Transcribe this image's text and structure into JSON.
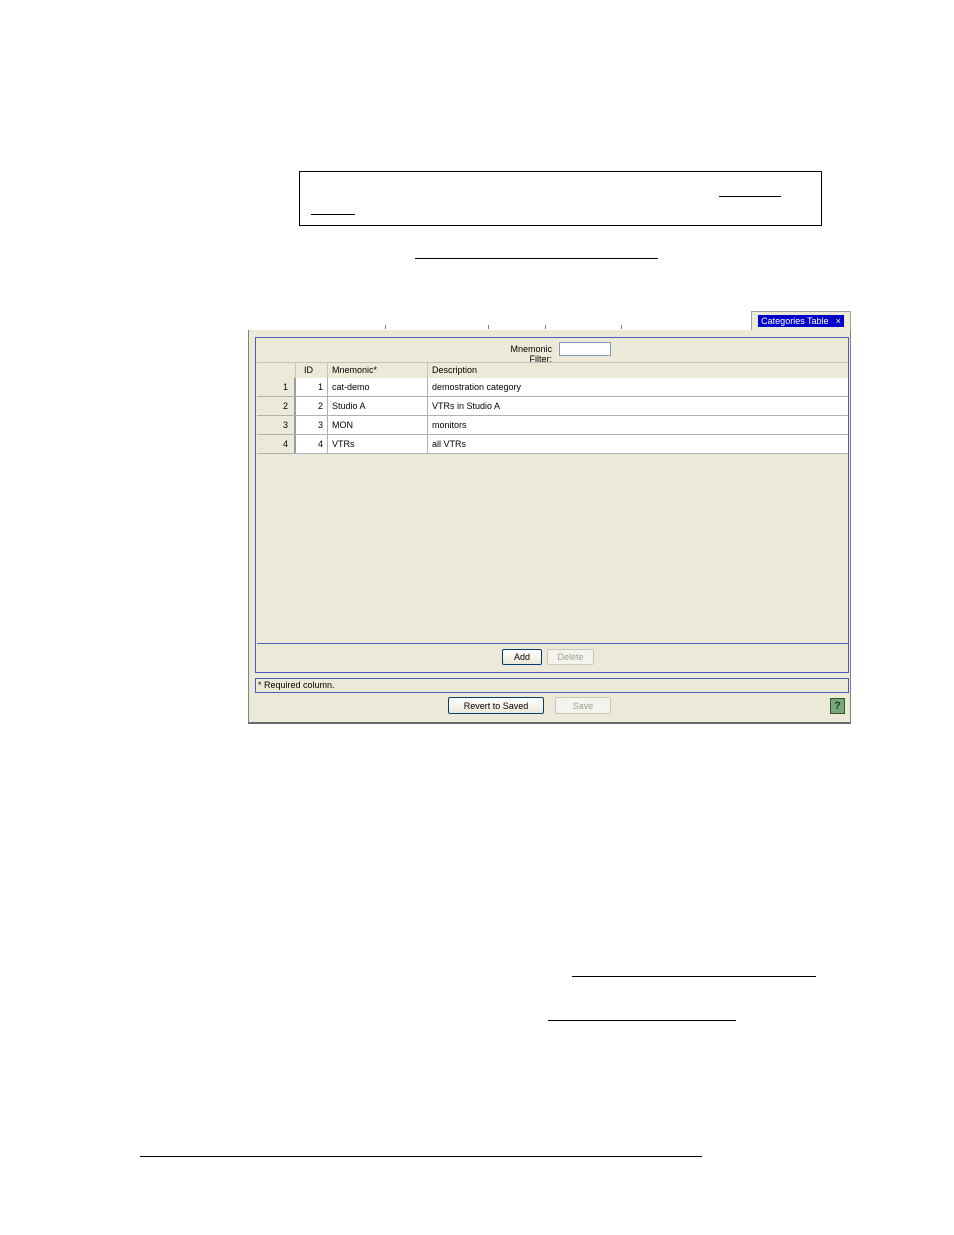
{
  "tab": {
    "label": "Categories Table",
    "close_glyph": "×"
  },
  "filter": {
    "label": "Mnemonic Filter:",
    "value": ""
  },
  "table": {
    "columns": [
      "ID",
      "Mnemonic*",
      "Description"
    ],
    "rows": [
      {
        "row_num": "1",
        "id": "1",
        "mnemonic": "cat-demo",
        "description": "demostration category"
      },
      {
        "row_num": "2",
        "id": "2",
        "mnemonic": "Studio A",
        "description": "VTRs in Studio A"
      },
      {
        "row_num": "3",
        "id": "3",
        "mnemonic": "MON",
        "description": "monitors"
      },
      {
        "row_num": "4",
        "id": "4",
        "mnemonic": "VTRs",
        "description": "all VTRs"
      }
    ]
  },
  "buttons": {
    "add": "Add",
    "delete": "Delete",
    "revert": "Revert to Saved",
    "save": "Save",
    "help": "?"
  },
  "status": {
    "required_note": "* Required column."
  },
  "colors": {
    "tab_highlight": "#0000c8",
    "panel_bg": "#ece9d8",
    "frame_border": "#4a5cb8",
    "help_green": "#7aa87a"
  }
}
